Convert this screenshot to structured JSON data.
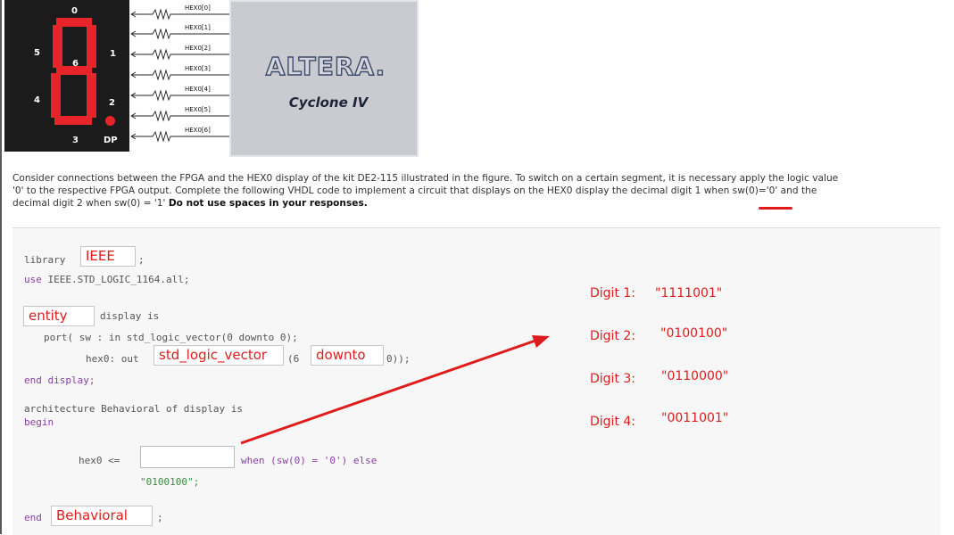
{
  "figure": {
    "segment_labels": [
      "0",
      "1",
      "2",
      "3",
      "4",
      "5",
      "6",
      "DP"
    ],
    "hex_pins": [
      "HEX0[0]",
      "HEX0[1]",
      "HEX0[2]",
      "HEX0[3]",
      "HEX0[4]",
      "HEX0[5]",
      "HEX0[6]"
    ],
    "chip_brand": "ALTERA.",
    "chip_family": "Cyclone IV",
    "segment_color": "#e8242b"
  },
  "question": {
    "line1": "Consider connections between the FPGA and the HEX0 display of the kit DE2-115 illustrated in the figure. To switch on a certain segment, it is necessary apply the logic value",
    "line2": "'0' to the respective FPGA output. Complete the following VHDL code to implement a circuit that displays on the HEX0 display the decimal digit 1 when sw(0)='0' and the",
    "line3_plain": "decimal digit 2 when sw(0) = '1' ",
    "line3_bold": "Do not use spaces in your responses."
  },
  "code": {
    "library_kw": "library",
    "library_answer": "IEEE",
    "semicolon": ";",
    "use_kw": "use",
    "use_rest": "IEEE.STD_LOGIC_1164.all;",
    "entity_answer": "entity",
    "entity_rest": "display is",
    "port_line": "port( sw : in std_logic_vector(0 downto 0);",
    "hex_out": "hex0: out",
    "type_answer": "std_logic_vector",
    "range_start": "(6",
    "downto_answer": "downto",
    "range_end": "0));",
    "end_display": "end display;",
    "arch_line": "architecture Behavioral of display is",
    "begin_kw": "begin",
    "assign_lhs": "hex0 <=",
    "blank_input": "",
    "when_clause": "when (sw(0) = '0') else",
    "else_value": "\"0100100\";",
    "end_kw": "end",
    "arch_answer": "Behavioral",
    "answer_color": "#e01b1b"
  },
  "digits": [
    {
      "label": "Digit 1:",
      "code": "\"1111001\""
    },
    {
      "label": "Digit 2:",
      "code": "\"0100100\""
    },
    {
      "label": "Digit 3:",
      "code": "\"0110000\""
    },
    {
      "label": "Digit 4:",
      "code": "\"0011001\""
    }
  ]
}
